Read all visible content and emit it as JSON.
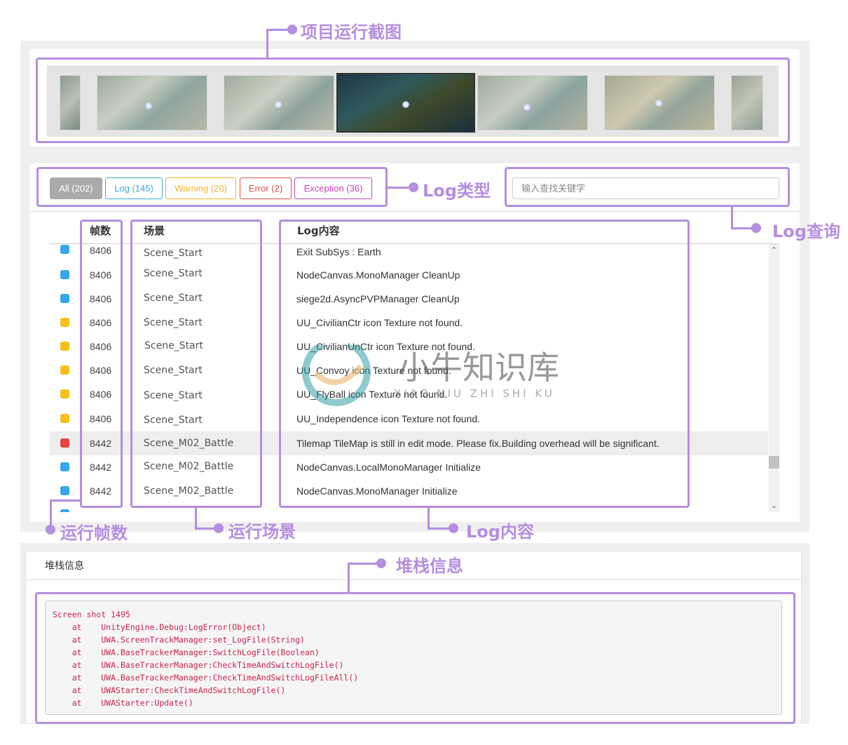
{
  "callouts": {
    "screenshots": "项目运行截图",
    "log_type": "Log类型",
    "log_query": "Log查询",
    "frames": "运行帧数",
    "scene": "运行场景",
    "log_content": "Log内容",
    "stack": "堆栈信息"
  },
  "filters": [
    {
      "label": "All (202)",
      "color": "#aaaaaa",
      "active": true
    },
    {
      "label": "Log (145)",
      "color": "#3ba9e0"
    },
    {
      "label": "Warning (20)",
      "color": "#f0b429"
    },
    {
      "label": "Error (2)",
      "color": "#d9534f"
    },
    {
      "label": "Exception (36)",
      "color": "#c046b8"
    }
  ],
  "search": {
    "placeholder": "输入查找关键字"
  },
  "table": {
    "headers": {
      "frame": "帧数",
      "scene": "场景",
      "log": "Log内容"
    },
    "rows": [
      {
        "color": "#35a7ea",
        "frame": "8406",
        "scene": "Scene_Start",
        "log": "Exit SubSys : Earth"
      },
      {
        "color": "#35a7ea",
        "frame": "8406",
        "scene": "Scene_Start",
        "log": "NodeCanvas.MonoManager CleanUp"
      },
      {
        "color": "#35a7ea",
        "frame": "8406",
        "scene": "Scene_Start",
        "log": "siege2d.AsyncPVPManager CleanUp"
      },
      {
        "color": "#f3c01c",
        "frame": "8406",
        "scene": "Scene_Start",
        "log": "UU_CivilianCtr icon Texture not found."
      },
      {
        "color": "#f3c01c",
        "frame": "8406",
        "scene": "Scene_Start",
        "log": "UU_CivilianUnCtr icon Texture not found."
      },
      {
        "color": "#f3c01c",
        "frame": "8406",
        "scene": "Scene_Start",
        "log": "UU_Convoy icon Texture not found."
      },
      {
        "color": "#f3c01c",
        "frame": "8406",
        "scene": "Scene_Start",
        "log": "UU_FlyBall icon Texture not found."
      },
      {
        "color": "#f3c01c",
        "frame": "8406",
        "scene": "Scene_Start",
        "log": "UU_Independence icon Texture not found."
      },
      {
        "color": "#e8453c",
        "frame": "8442",
        "scene": "Scene_M02_Battle",
        "log": "Tilemap TileMap is still in edit mode. Please fix.Building overhead will be significant.",
        "selected": true
      },
      {
        "color": "#35a7ea",
        "frame": "8442",
        "scene": "Scene_M02_Battle",
        "log": "NodeCanvas.LocalMonoManager Initialize"
      },
      {
        "color": "#35a7ea",
        "frame": "8442",
        "scene": "Scene_M02_Battle",
        "log": "NodeCanvas.MonoManager Initialize"
      }
    ]
  },
  "stack_panel": {
    "title": "堆栈信息",
    "lines": [
      "Screen shot 1495",
      "    at    UnityEngine.Debug:LogError(Object)",
      "    at    UWA.ScreenTrackManager:set_LogFile(String)",
      "    at    UWA.BaseTrackerManager:SwitchLogFile(Boolean)",
      "    at    UWA.BaseTrackerManager:CheckTimeAndSwitchLogFile()",
      "    at    UWA.BaseTrackerManager:CheckTimeAndSwitchLogFileAll()",
      "    at    UWAStarter:CheckTimeAndSwitchLogFile()",
      "    at    UWAStarter:Update()"
    ]
  },
  "watermark": {
    "cn": "小牛知识库",
    "en": "XIAO NIU ZHI SHI KU"
  },
  "icons": {
    "scroll_up": "chevron-up-icon",
    "scroll_down": "chevron-down-icon",
    "dot": "dot-icon"
  }
}
